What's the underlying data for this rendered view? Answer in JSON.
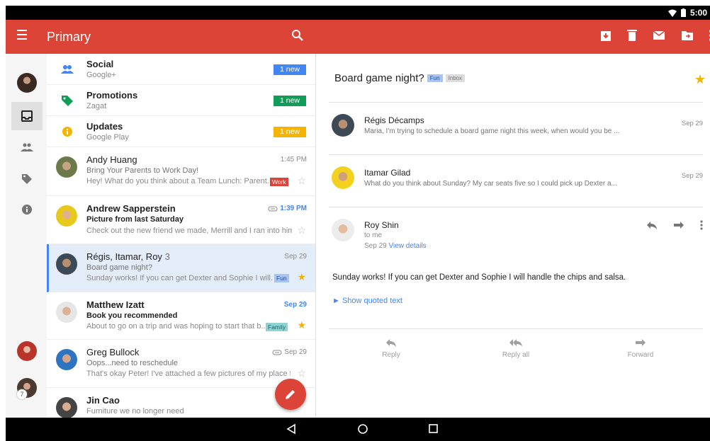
{
  "status_bar": {
    "time": "5:00"
  },
  "app_bar": {
    "title": "Primary"
  },
  "categories": [
    {
      "name": "Social",
      "sub": "Google+",
      "tag": "1 new",
      "color": "#4285f4",
      "icon": "people-icon"
    },
    {
      "name": "Promotions",
      "sub": "Zagat",
      "tag": "1 new",
      "color": "#0f9d58",
      "icon": "tag-icon"
    },
    {
      "name": "Updates",
      "sub": "Google Play",
      "tag": "1 new",
      "color": "#f4b400",
      "icon": "info-icon"
    }
  ],
  "mails": [
    {
      "sender": "Andy Huang",
      "subject": "Bring Your Parents to Work Day!",
      "snippet": "Hey! What do you think about a Team Lunch: Parent...",
      "time": "1:45 PM",
      "label": "Work"
    },
    {
      "sender": "Andrew Sapperstein",
      "subject": "Picture from last Saturday",
      "snippet": "Check out the new friend we made, Merrill and I ran into him...",
      "time": "1:39 PM"
    },
    {
      "sender": "Régis, Itamar, Roy",
      "count": "3",
      "subject": "Board game night?",
      "snippet": "Sunday works! If you can get Dexter and Sophie I will...",
      "time": "Sep 29",
      "label": "Fun"
    },
    {
      "sender": "Matthew Izatt",
      "subject": "Book you recommended",
      "snippet": "About to go on a trip and was hoping to start that b...",
      "time": "Sep 29",
      "label": "Family"
    },
    {
      "sender": "Greg Bullock",
      "subject": "Oops...need to reschedule",
      "snippet": "That's okay Peter! I've attached a few pictures of my place f...",
      "time": "Sep 29"
    },
    {
      "sender": "Jin Cao",
      "subject": "Furniture we no longer need"
    }
  ],
  "rail": {
    "account_badge": "7"
  },
  "detail": {
    "subject": "Board game night?",
    "labels": [
      "Fun",
      "Inbox"
    ],
    "messages": [
      {
        "name": "Régis Décamps",
        "snippet": "Maria, I'm trying to schedule a board game night this week, when would you be ...",
        "date": "Sep 29"
      },
      {
        "name": "Itamar Gilad",
        "snippet": "What do you think about Sunday? My car seats five so I could pick up Dexter a...",
        "date": "Sep 29"
      }
    ],
    "open": {
      "name": "Roy Shin",
      "to": "to me",
      "date": "Sep 29",
      "view_details": "View details",
      "body": "Sunday works! If you can get Dexter and Sophie I will handle the chips and salsa.",
      "quoted": "Show quoted text"
    },
    "actions": {
      "reply": "Reply",
      "reply_all": "Reply all",
      "forward": "Forward"
    }
  }
}
